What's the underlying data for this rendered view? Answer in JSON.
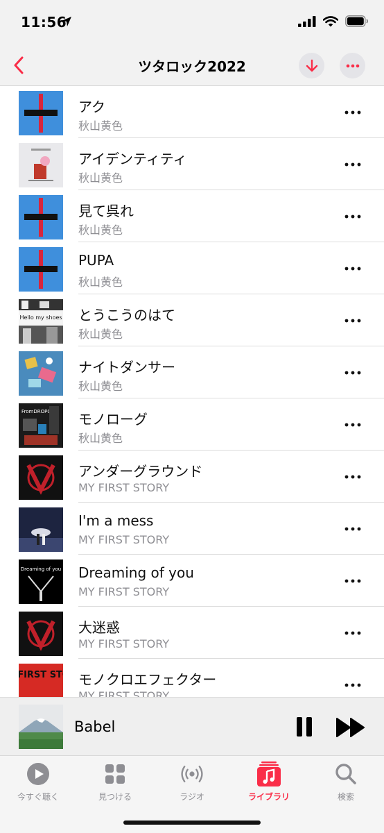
{
  "status": {
    "time": "11:56"
  },
  "header": {
    "title": "ツタロック2022"
  },
  "tracks": [
    {
      "title": "アク",
      "artist": "秋山黄色"
    },
    {
      "title": "アイデンティティ",
      "artist": "秋山黄色"
    },
    {
      "title": "見て呉れ",
      "artist": "秋山黄色"
    },
    {
      "title": "PUPA",
      "artist": "秋山黄色"
    },
    {
      "title": "とうこうのはて",
      "artist": "秋山黄色",
      "art_text": "Hello my shoes"
    },
    {
      "title": "ナイトダンサー",
      "artist": "秋山黄色"
    },
    {
      "title": "モノローグ",
      "artist": "秋山黄色",
      "art_text": "FromDROPOUT"
    },
    {
      "title": "アンダーグラウンド",
      "artist": "MY FIRST STORY"
    },
    {
      "title": "I'm a mess",
      "artist": "MY FIRST STORY"
    },
    {
      "title": "Dreaming of you",
      "artist": "MY FIRST STORY",
      "art_text": "Dreaming of you"
    },
    {
      "title": "大迷惑",
      "artist": "MY FIRST STORY"
    },
    {
      "title": "モノクロエフェクター",
      "artist": "MY FIRST STORY",
      "art_text": "MY FIRST STORY"
    }
  ],
  "now_playing": {
    "title": "Babel"
  },
  "tabs": [
    {
      "label": "今すぐ聴く",
      "icon": "play-circle-icon"
    },
    {
      "label": "見つける",
      "icon": "grid-icon"
    },
    {
      "label": "ラジオ",
      "icon": "radio-waves-icon"
    },
    {
      "label": "ライブラリ",
      "icon": "music-library-icon",
      "active": true
    },
    {
      "label": "検索",
      "icon": "search-icon"
    }
  ],
  "colors": {
    "accent": "#fa2d48",
    "secondary_text": "#8e8e93",
    "bar_bg": "#f2f2f2"
  }
}
